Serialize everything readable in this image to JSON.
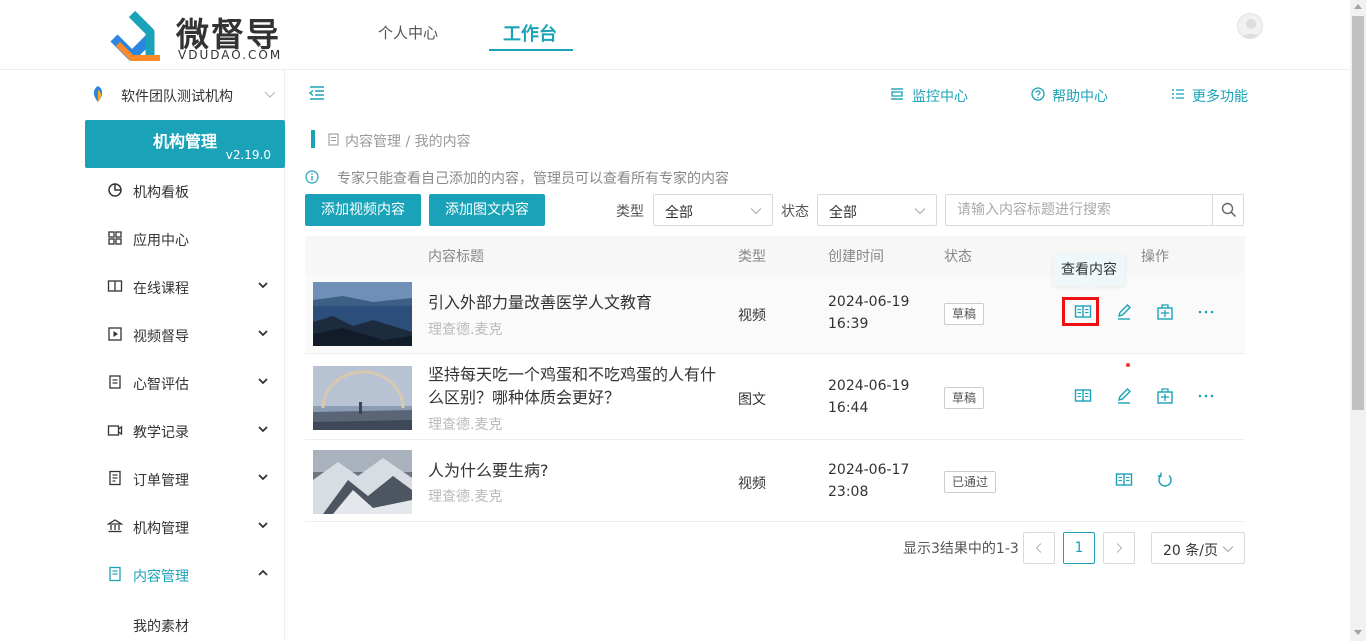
{
  "app": {
    "logo_cn": "微督导",
    "logo_en": "VDUDAO.COM"
  },
  "nav": {
    "personal": "个人中心",
    "workbench": "工作台"
  },
  "sidebar": {
    "org_name": "软件团队测试机构",
    "card_title": "机构管理",
    "version": "v2.19.0",
    "items": [
      {
        "label": "机构看板",
        "icon": "pie-chart-icon"
      },
      {
        "label": "应用中心",
        "icon": "grid-icon"
      },
      {
        "label": "在线课程",
        "icon": "book-icon"
      },
      {
        "label": "视频督导",
        "icon": "play-icon"
      },
      {
        "label": "心智评估",
        "icon": "clipboard-icon"
      },
      {
        "label": "教学记录",
        "icon": "video-icon"
      },
      {
        "label": "订单管理",
        "icon": "order-icon"
      },
      {
        "label": "机构管理",
        "icon": "bank-icon"
      },
      {
        "label": "内容管理",
        "icon": "document-icon"
      }
    ],
    "sub_item": "我的素材"
  },
  "header_links": {
    "monitor": "监控中心",
    "help": "帮助中心",
    "more": "更多功能"
  },
  "breadcrumb": "内容管理 / 我的内容",
  "info_text": "专家只能查看自己添加的内容，管理员可以查看所有专家的内容",
  "buttons": {
    "add_video": "添加视频内容",
    "add_article": "添加图文内容"
  },
  "filters": {
    "type_label": "类型",
    "type_value": "全部",
    "status_label": "状态",
    "status_value": "全部",
    "search_placeholder": "请输入内容标题进行搜索"
  },
  "table": {
    "headers": {
      "title": "内容标题",
      "type": "类型",
      "created": "创建时间",
      "status": "状态",
      "actions": "操作"
    },
    "rows": [
      {
        "title": "引入外部力量改善医学人文教育",
        "author": "理查德.麦克",
        "type": "视频",
        "date": "2024-06-19",
        "time": "16:39",
        "status": "草稿"
      },
      {
        "title": "坚持每天吃一个鸡蛋和不吃鸡蛋的人有什么区别？哪种体质会更好？",
        "author": "理查德.麦克",
        "type": "图文",
        "date": "2024-06-19",
        "time": "16:44",
        "status": "草稿"
      },
      {
        "title": "人为什么要生病?",
        "author": "理查德.麦克",
        "type": "视频",
        "date": "2024-06-17",
        "time": "23:08",
        "status": "已通过"
      }
    ]
  },
  "tooltip": "查看内容",
  "pager": {
    "info": "显示3结果中的1-3",
    "current": "1",
    "size": "20 条/页"
  },
  "colors": {
    "accent": "#1aa3b8",
    "highlight": "#ee1111"
  }
}
